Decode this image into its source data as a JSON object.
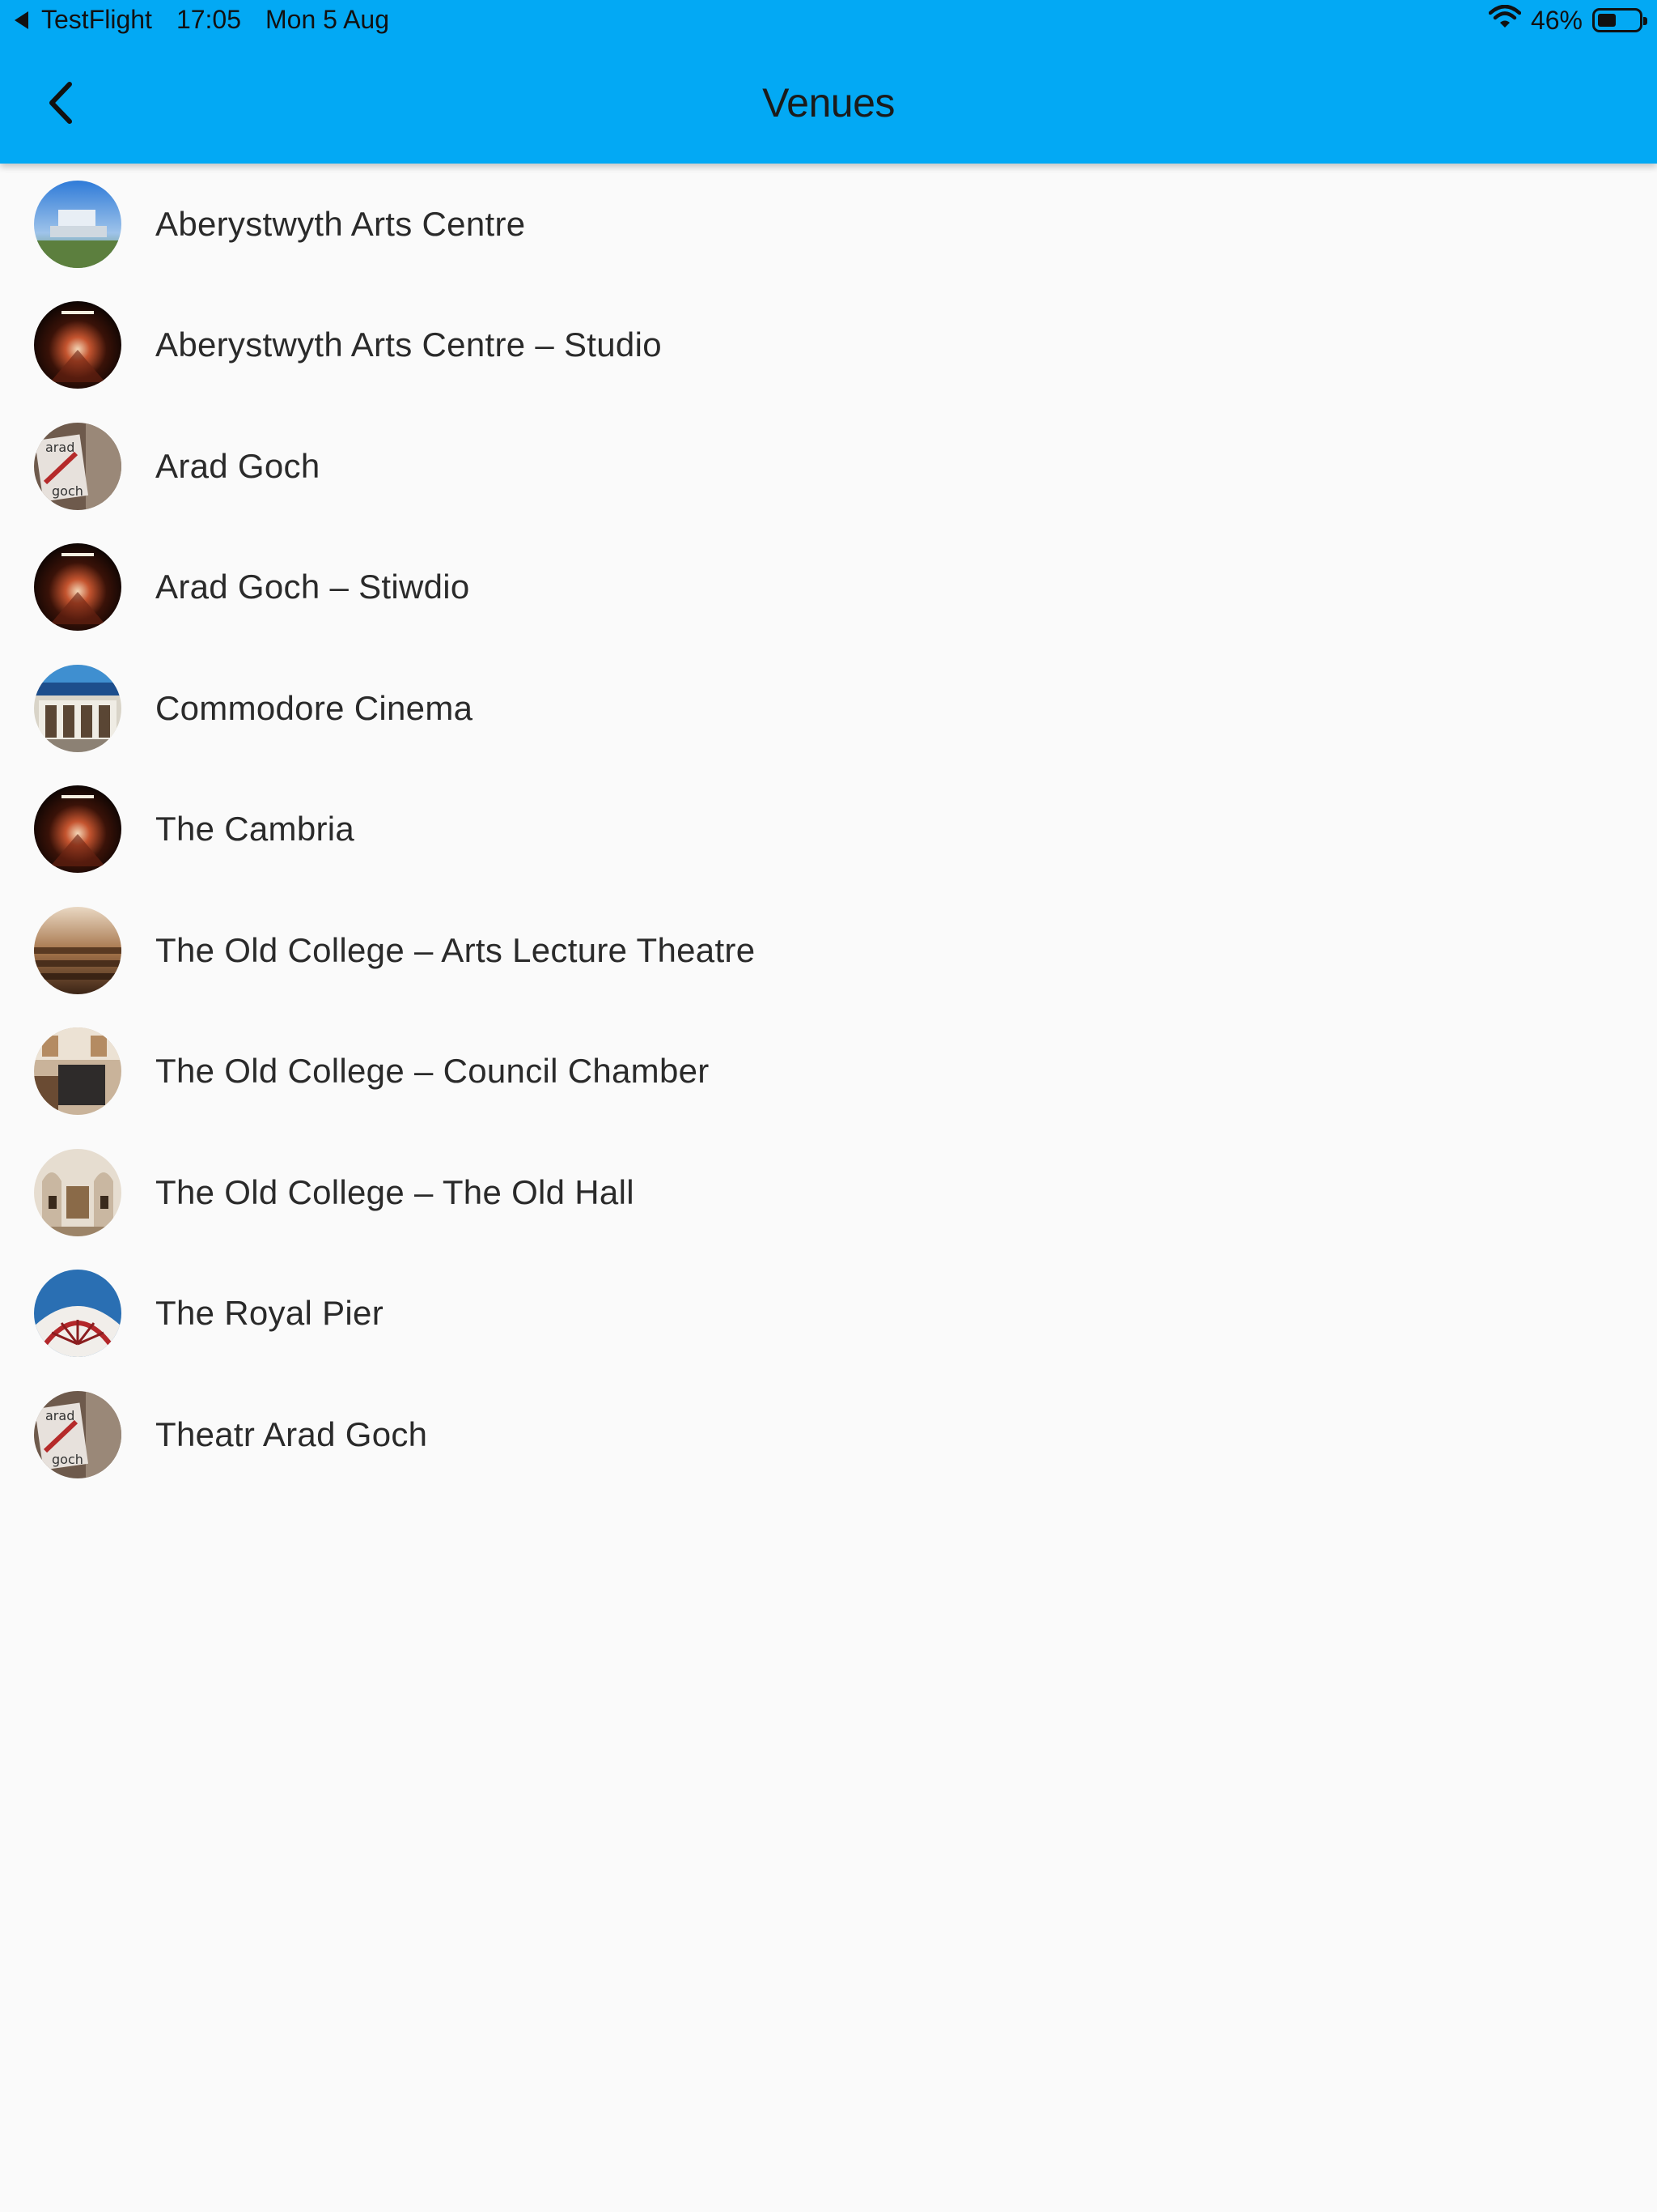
{
  "status_bar": {
    "back_app": "TestFlight",
    "time": "17:05",
    "date": "Mon 5 Aug",
    "battery": "46%",
    "battery_level": 0.46
  },
  "app_bar": {
    "title": "Venues",
    "back_icon": "chevron-left-icon"
  },
  "colors": {
    "app_bar": "#03a9f4",
    "background": "#fafafa",
    "text": "#2a2a2a"
  },
  "venues": [
    {
      "name": "Aberystwyth Arts Centre"
    },
    {
      "name": "Aberystwyth Arts Centre – Studio"
    },
    {
      "name": "Arad Goch"
    },
    {
      "name": "Arad Goch – Stiwdio"
    },
    {
      "name": "Commodore Cinema"
    },
    {
      "name": "The Cambria"
    },
    {
      "name": "The Old College – Arts Lecture Theatre"
    },
    {
      "name": "The Old College – Council Chamber"
    },
    {
      "name": "The Old College – The Old Hall"
    },
    {
      "name": "The Royal Pier"
    },
    {
      "name": "Theatr Arad Goch"
    }
  ]
}
